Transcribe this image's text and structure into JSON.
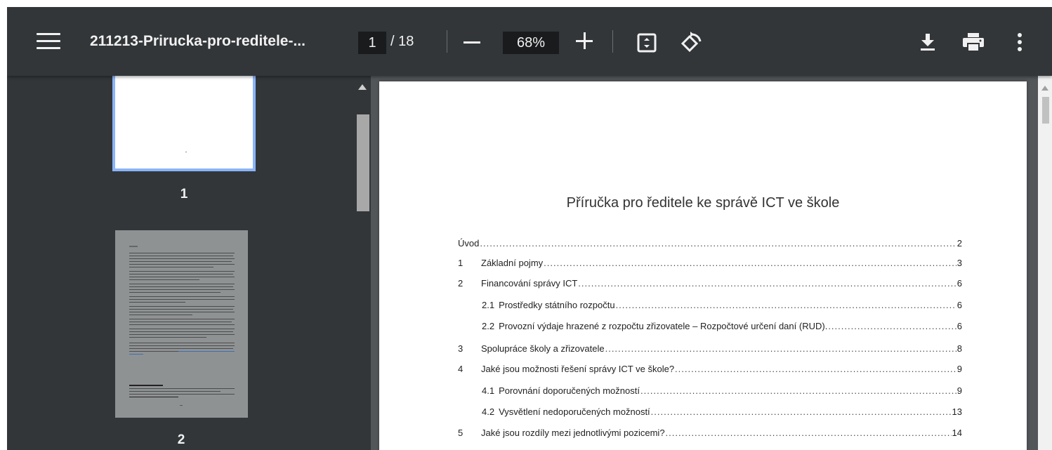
{
  "toolbar": {
    "title": "211213-Prirucka-pro-reditele-...",
    "page_current": "1",
    "page_total": "/ 18",
    "zoom": "68%"
  },
  "thumbnails": [
    {
      "number": "1"
    },
    {
      "number": "2"
    }
  ],
  "document": {
    "title": "Příručka pro ředitele ke správě ICT ve škole",
    "toc": [
      {
        "num": "",
        "text": "Úvod",
        "page": "2",
        "level": 0
      },
      {
        "num": "1",
        "text": "Základní pojmy",
        "page": "3",
        "level": 1
      },
      {
        "num": "2",
        "text": "Financování správy ICT",
        "page": "6",
        "level": 1
      },
      {
        "num": "2.1",
        "text": "Prostředky státního rozpočtu",
        "page": "6",
        "level": 2
      },
      {
        "num": "2.2",
        "text": "Provozní výdaje hrazené z rozpočtu zřizovatele – Rozpočtové určení daní (RUD).",
        "page": "6",
        "level": 2
      },
      {
        "num": "3",
        "text": "Spolupráce školy a zřizovatele",
        "page": "8",
        "level": 1
      },
      {
        "num": "4",
        "text": "Jaké jsou možnosti řešení správy ICT ve škole?",
        "page": "9",
        "level": 1
      },
      {
        "num": "4.1",
        "text": "Porovnání doporučených možností",
        "page": "9",
        "level": 2
      },
      {
        "num": "4.2",
        "text": "Vysvětlení nedoporučených možností",
        "page": "13",
        "level": 2
      },
      {
        "num": "5",
        "text": "Jaké jsou rozdíly mezi jednotlivými pozicemi?",
        "page": "14",
        "level": 1
      }
    ]
  },
  "icons": {
    "menu": "menu-icon",
    "fit": "fit-page-icon",
    "rotate": "rotate-icon",
    "download": "download-icon",
    "print": "print-icon",
    "more": "more-vert-icon"
  },
  "colors": {
    "toolbar": "#323639",
    "viewer_bg": "#525659",
    "thumb_selected": "#8ab4f8"
  }
}
